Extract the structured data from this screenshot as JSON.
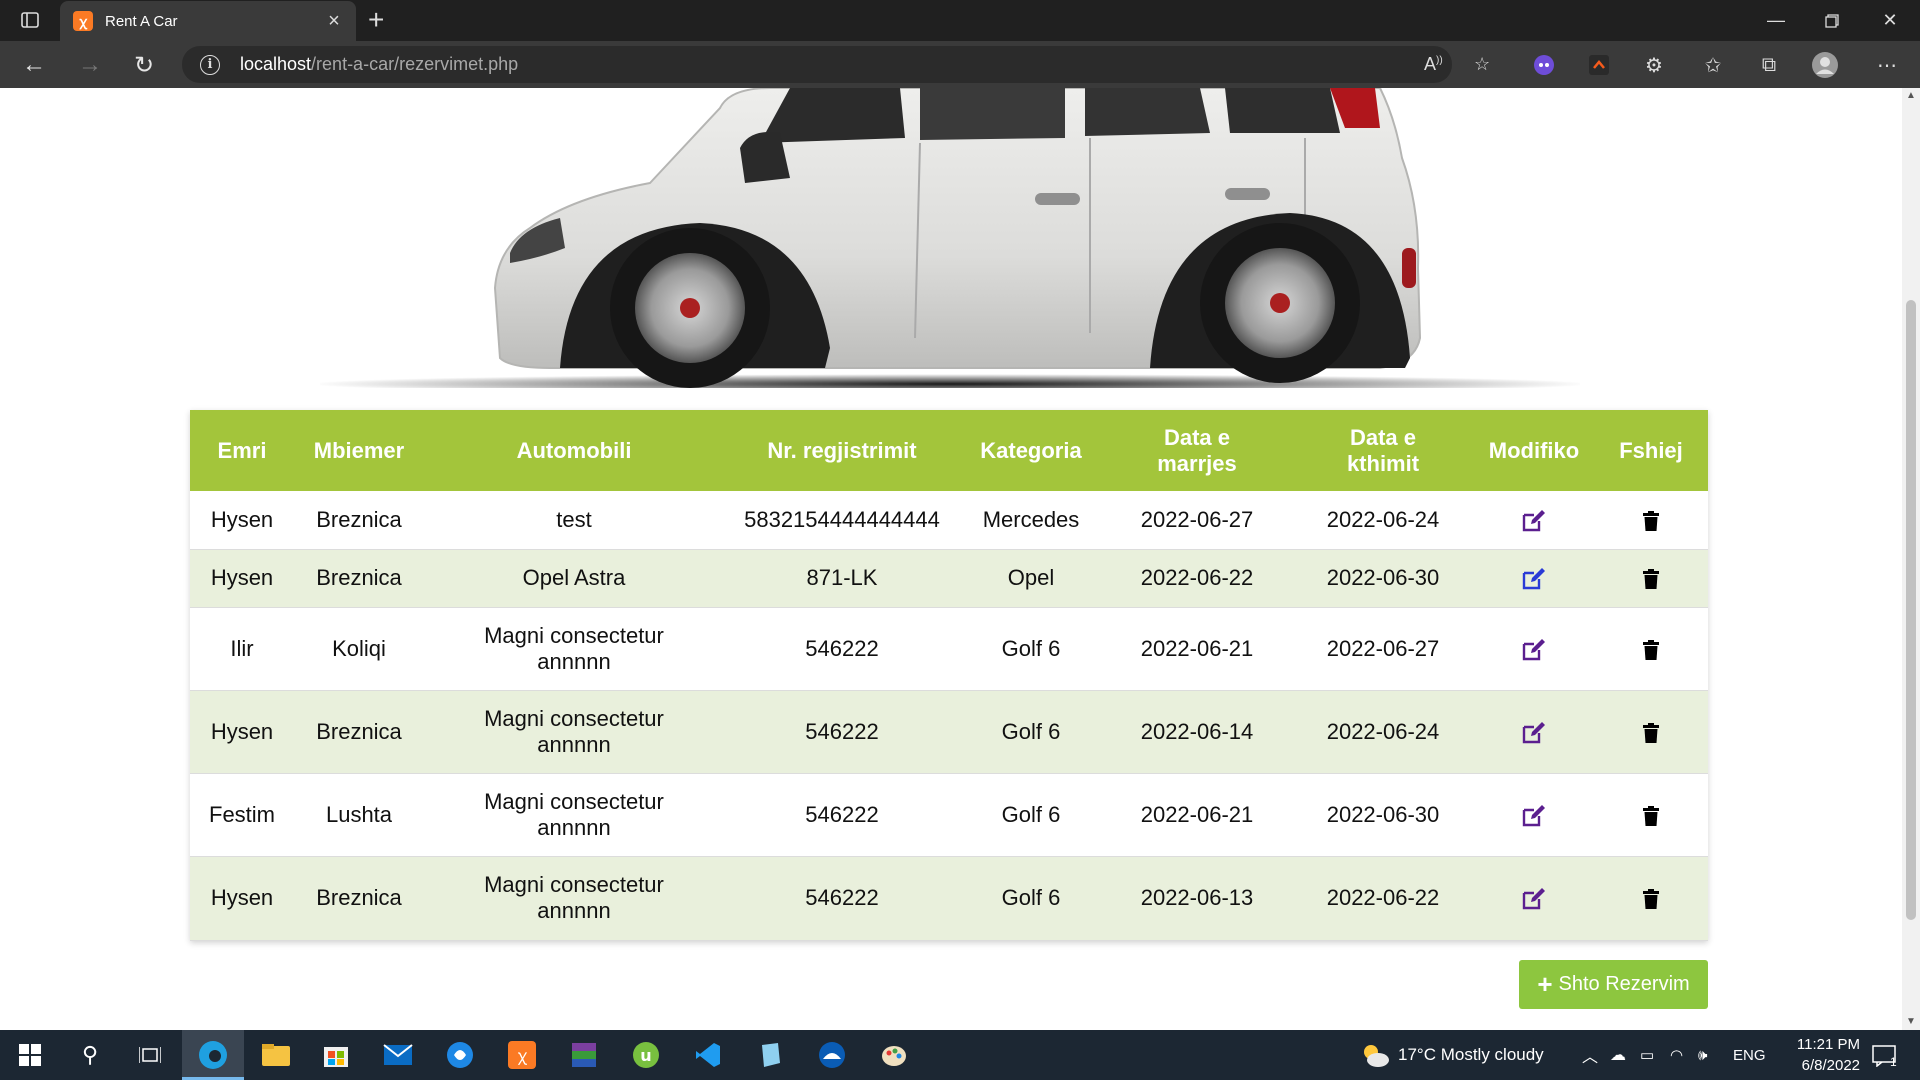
{
  "browser": {
    "tab_title": "Rent A Car",
    "url_host": "localhost",
    "url_path": "/rent-a-car/rezervimet.php"
  },
  "table": {
    "headers": [
      {
        "line1": "Emri",
        "line2": ""
      },
      {
        "line1": "Mbiemer",
        "line2": ""
      },
      {
        "line1": "Automobili",
        "line2": ""
      },
      {
        "line1": "Nr. regjistrimit",
        "line2": ""
      },
      {
        "line1": "Kategoria",
        "line2": ""
      },
      {
        "line1": "Data e",
        "line2": "marrjes"
      },
      {
        "line1": "Data e",
        "line2": "kthimit"
      },
      {
        "line1": "Modifiko",
        "line2": ""
      },
      {
        "line1": "Fshiej",
        "line2": ""
      }
    ],
    "rows": [
      {
        "emri": "Hysen",
        "mbiemer": "Breznica",
        "auto1": "test",
        "auto2": "",
        "nr": "5832154444444444",
        "kategoria": "Mercedes",
        "marrjes": "2022-06-27",
        "kthimit": "2022-06-24"
      },
      {
        "emri": "Hysen",
        "mbiemer": "Breznica",
        "auto1": "Opel Astra",
        "auto2": "",
        "nr": "871-LK",
        "kategoria": "Opel",
        "marrjes": "2022-06-22",
        "kthimit": "2022-06-30"
      },
      {
        "emri": "Ilir",
        "mbiemer": "Koliqi",
        "auto1": "Magni consectetur",
        "auto2": "annnnn",
        "nr": "546222",
        "kategoria": "Golf 6",
        "marrjes": "2022-06-21",
        "kthimit": "2022-06-27"
      },
      {
        "emri": "Hysen",
        "mbiemer": "Breznica",
        "auto1": "Magni consectetur",
        "auto2": "annnnn",
        "nr": "546222",
        "kategoria": "Golf 6",
        "marrjes": "2022-06-14",
        "kthimit": "2022-06-24"
      },
      {
        "emri": "Festim",
        "mbiemer": "Lushta",
        "auto1": "Magni consectetur",
        "auto2": "annnnn",
        "nr": "546222",
        "kategoria": "Golf 6",
        "marrjes": "2022-06-21",
        "kthimit": "2022-06-30"
      },
      {
        "emri": "Hysen",
        "mbiemer": "Breznica",
        "auto1": "Magni consectetur",
        "auto2": "annnnn",
        "nr": "546222",
        "kategoria": "Golf 6",
        "marrjes": "2022-06-13",
        "kthimit": "2022-06-22"
      }
    ]
  },
  "add_button_label": "Shto Rezervim",
  "colors": {
    "header_green": "#a3c53b",
    "button_green": "#8dc63f",
    "icon_purple": "#5b1f8f"
  },
  "taskbar": {
    "weather": "17°C  Mostly cloudy",
    "language": "ENG",
    "time": "11:21 PM",
    "date": "6/8/2022",
    "notification_count": "1"
  }
}
